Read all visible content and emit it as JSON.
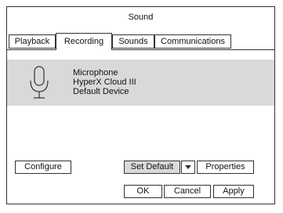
{
  "window": {
    "title": "Sound"
  },
  "tabs": [
    {
      "label": "Playback"
    },
    {
      "label": "Recording"
    },
    {
      "label": "Sounds"
    },
    {
      "label": "Communications"
    }
  ],
  "active_tab": "Recording",
  "device": {
    "icon": "microphone-icon",
    "name": "Microphone",
    "model": "HyperX Cloud III",
    "status": "Default Device"
  },
  "buttons": {
    "configure": "Configure",
    "set_default": "Set Default",
    "properties": "Properties",
    "ok": "OK",
    "cancel": "Cancel",
    "apply": "Apply"
  }
}
